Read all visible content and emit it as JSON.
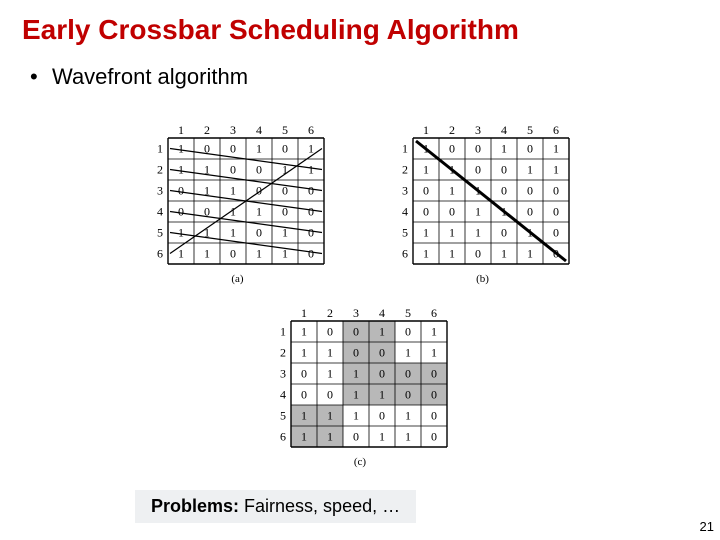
{
  "title": "Early Crossbar Scheduling Algorithm",
  "bullet": {
    "marker": "•",
    "text": "Wavefront algorithm"
  },
  "figures": {
    "cols": [
      "1",
      "2",
      "3",
      "4",
      "5",
      "6"
    ],
    "rows": [
      "1",
      "2",
      "3",
      "4",
      "5",
      "6"
    ],
    "a": {
      "label": "(a)",
      "matrix": [
        [
          "1",
          "0",
          "0",
          "1",
          "0",
          "1"
        ],
        [
          "1",
          "1",
          "0",
          "0",
          "1",
          "1"
        ],
        [
          "0",
          "1",
          "1",
          "0",
          "0",
          "0"
        ],
        [
          "0",
          "0",
          "1",
          "1",
          "0",
          "0"
        ],
        [
          "1",
          "1",
          "1",
          "0",
          "1",
          "0"
        ],
        [
          "1",
          "1",
          "0",
          "1",
          "1",
          "0"
        ]
      ]
    },
    "b": {
      "label": "(b)",
      "matrix": [
        [
          "1",
          "0",
          "0",
          "1",
          "0",
          "1"
        ],
        [
          "1",
          "1",
          "0",
          "0",
          "1",
          "1"
        ],
        [
          "0",
          "1",
          "1",
          "0",
          "0",
          "0"
        ],
        [
          "0",
          "0",
          "1",
          "1",
          "0",
          "0"
        ],
        [
          "1",
          "1",
          "1",
          "0",
          "1",
          "0"
        ],
        [
          "1",
          "1",
          "0",
          "1",
          "1",
          "0"
        ]
      ]
    },
    "c": {
      "label": "(c)",
      "matrix": [
        [
          "1",
          "0",
          "0",
          "1",
          "0",
          "1"
        ],
        [
          "1",
          "1",
          "0",
          "0",
          "1",
          "1"
        ],
        [
          "0",
          "1",
          "1",
          "0",
          "0",
          "0"
        ],
        [
          "0",
          "0",
          "1",
          "1",
          "0",
          "0"
        ],
        [
          "1",
          "1",
          "1",
          "0",
          "1",
          "0"
        ],
        [
          "1",
          "1",
          "0",
          "1",
          "1",
          "0"
        ]
      ]
    }
  },
  "problems": {
    "label": "Problems:",
    "text": " Fairness, speed, …"
  },
  "page_number": "21"
}
